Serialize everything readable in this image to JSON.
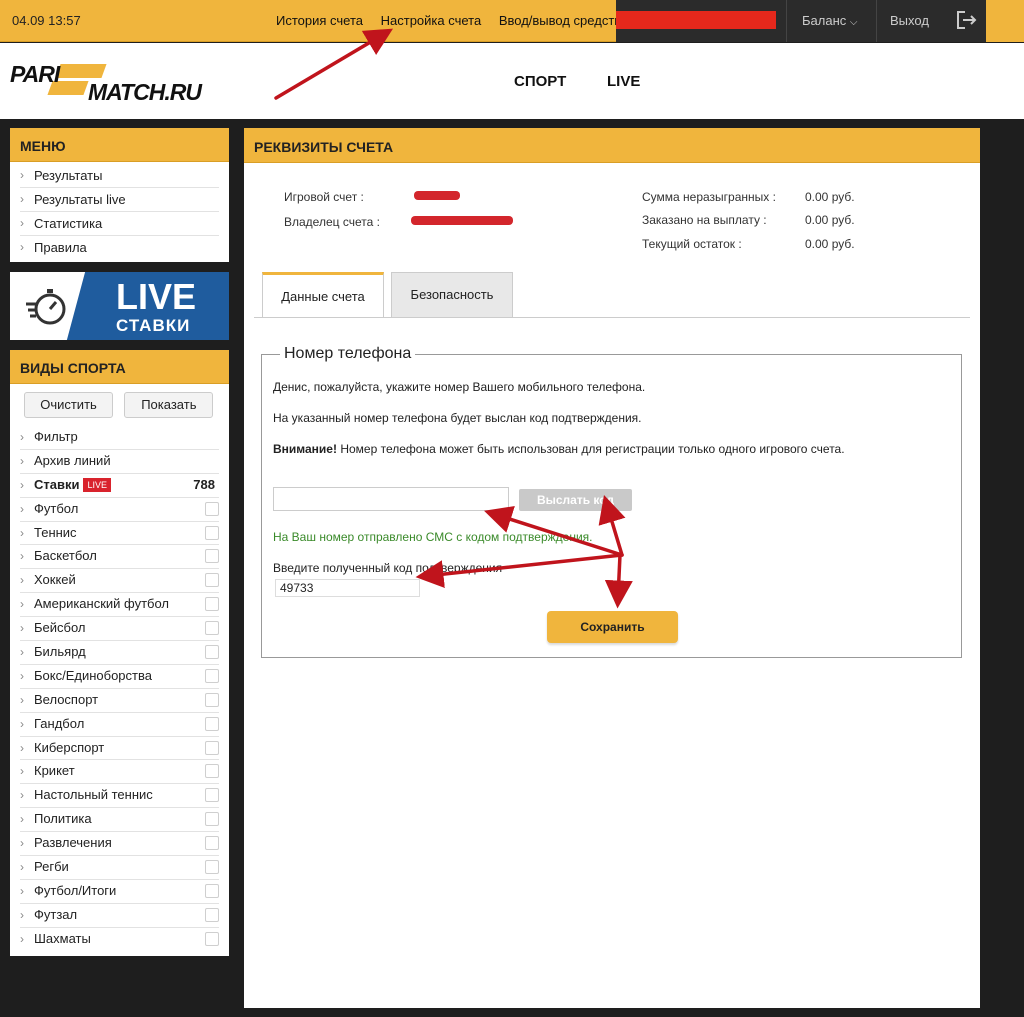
{
  "topbar": {
    "time": "04.09 13:57",
    "links": [
      "История счета",
      "Настройка счета",
      "Ввод/вывод средств"
    ],
    "balance": "Баланс",
    "logout": "Выход"
  },
  "header": {
    "logo_top": "PARI",
    "logo_bottom": "MATCH.RU",
    "nav": [
      "СПОРТ",
      "LIVE"
    ]
  },
  "menu": {
    "title": "МЕНЮ",
    "items": [
      "Результаты",
      "Результаты live",
      "Статистика",
      "Правила"
    ]
  },
  "live_banner": {
    "line1": "LIVE",
    "line2": "СТАВКИ"
  },
  "sports": {
    "title": "ВИДЫ СПОРТА",
    "clear_label": "Очистить",
    "show_label": "Показать",
    "filter": "Фильтр",
    "archive": "Архив линий",
    "bets": "Ставки",
    "live_badge": "LIVE",
    "bets_count": "788",
    "items": [
      "Футбол",
      "Теннис",
      "Баскетбол",
      "Хоккей",
      "Американский футбол",
      "Бейсбол",
      "Бильярд",
      "Бокс/Единоборства",
      "Велоспорт",
      "Гандбол",
      "Киберспорт",
      "Крикет",
      "Настольный теннис",
      "Политика",
      "Развлечения",
      "Регби",
      "Футбол/Итоги",
      "Футзал",
      "Шахматы"
    ]
  },
  "main": {
    "title": "РЕКВИЗИТЫ СЧЕТА",
    "account_label": "Игровой счет :",
    "owner_label": "Владелец счета :",
    "unplayed_label": "Сумма неразыгранных :",
    "unplayed_value": "0.00 руб.",
    "ordered_label": "Заказано на выплату :",
    "ordered_value": "0.00 руб.",
    "balance_label": "Текущий остаток :",
    "balance_value": "0.00 руб.",
    "tabs": [
      "Данные счета",
      "Безопасность"
    ]
  },
  "phone": {
    "legend": "Номер телефона",
    "line1": "Денис, пожалуйста, укажите номер Вашего мобильного телефона.",
    "line2": "На указанный номер телефона будет выслан код подтверждения.",
    "warning_bold": "Внимание!",
    "warning_text": " Номер телефона может быть использован для регистрации только одного игрового счета.",
    "phone_value": "",
    "send_label": "Выслать код",
    "sms_note": "На Ваш номер отправлено СМС с кодом подтверждения.",
    "code_label": "Введите полученный код подтверждения",
    "code_value": "49733",
    "save_label": "Сохранить"
  },
  "colors": {
    "accent": "#f0b53d",
    "annotation": "#c0141c",
    "live_blue": "#1f5c9e"
  }
}
